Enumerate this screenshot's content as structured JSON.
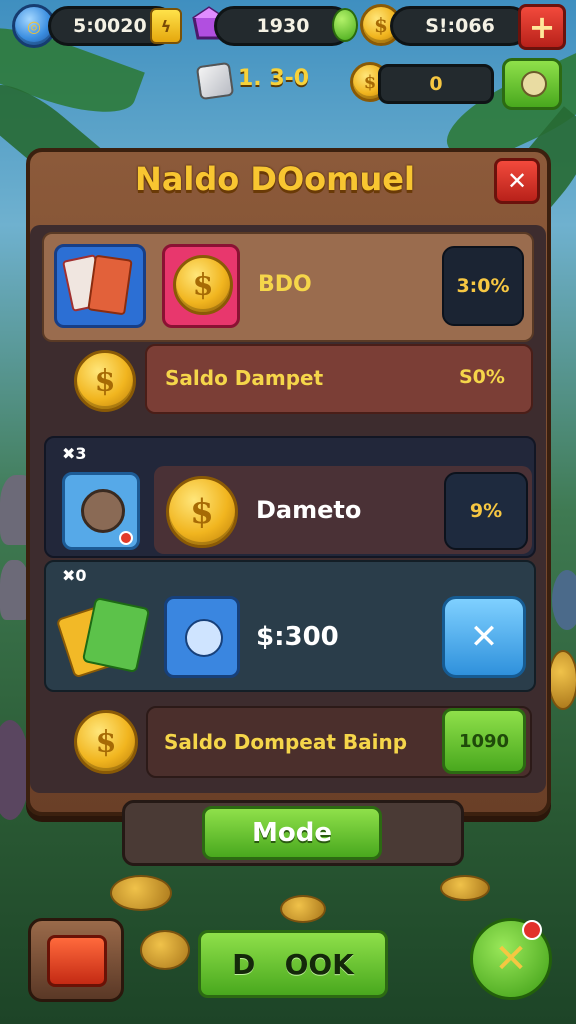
{
  "topbar": {
    "balance": "5:0020",
    "gems": "1930",
    "coins": "S!:066",
    "add_label": "+",
    "level": "1. 3-0",
    "secondary_coins": "0"
  },
  "panel": {
    "title": "Naldo DOomuel",
    "close_label": "✕",
    "rows": [
      {
        "label": "BDO",
        "value": "3:0%"
      },
      {
        "label": "Saldo Dampet",
        "value": "S0%"
      },
      {
        "label": "Dameto",
        "value": "9%",
        "tag": "✖3"
      },
      {
        "label": "$:300",
        "value": "✕",
        "tag": "✖0"
      },
      {
        "label": "Saldo Dompeat Bainp",
        "value": "1090"
      }
    ],
    "mode_label": "Mode"
  },
  "bottom": {
    "ok_label": "D   OOK",
    "cancel_label": "✕"
  },
  "colors": {
    "gold": "#f8c631",
    "green": "#5cc227",
    "red": "#d8312a",
    "panel": "#7a4b30"
  }
}
